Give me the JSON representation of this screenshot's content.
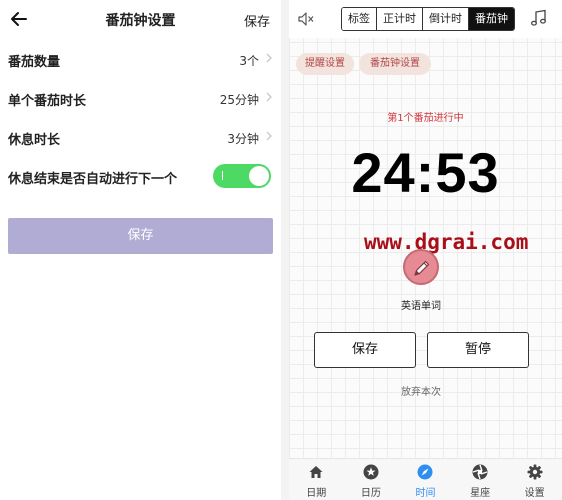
{
  "left": {
    "header": {
      "title": "番茄钟设置",
      "save": "保存"
    },
    "rows": [
      {
        "label": "番茄数量",
        "value": "3个"
      },
      {
        "label": "单个番茄时长",
        "value": "25分钟"
      },
      {
        "label": "休息时长",
        "value": "3分钟"
      }
    ],
    "toggle_row": {
      "label": "休息结束是否自动进行下一个",
      "on": true
    },
    "save_button": "保存"
  },
  "right": {
    "mode_tabs": [
      "标签",
      "正计时",
      "倒计时",
      "番茄钟"
    ],
    "active_mode": "番茄钟",
    "chips": [
      "提醒设置",
      "番茄钟设置"
    ],
    "session_label": "第1个番茄进行中",
    "timer": "24:53",
    "watermark": "www.dgrai.com",
    "task_name": "英语单词",
    "buttons": {
      "save": "保存",
      "pause": "暂停"
    },
    "abandon": "放弃本次",
    "bottom_tabs": [
      {
        "label": "日期",
        "icon": "home-icon"
      },
      {
        "label": "日历",
        "icon": "star-icon"
      },
      {
        "label": "时间",
        "icon": "compass-icon"
      },
      {
        "label": "星座",
        "icon": "aperture-icon"
      },
      {
        "label": "设置",
        "icon": "gear-icon"
      }
    ],
    "active_tab": "时间",
    "colors": {
      "accent": "#2f8ff0",
      "timer_label": "#d0393e",
      "toggle": "#4cd964",
      "save_button": "#b1acd3",
      "chip_bg": "#f2e3dc",
      "watermark": "#a90f19"
    }
  }
}
